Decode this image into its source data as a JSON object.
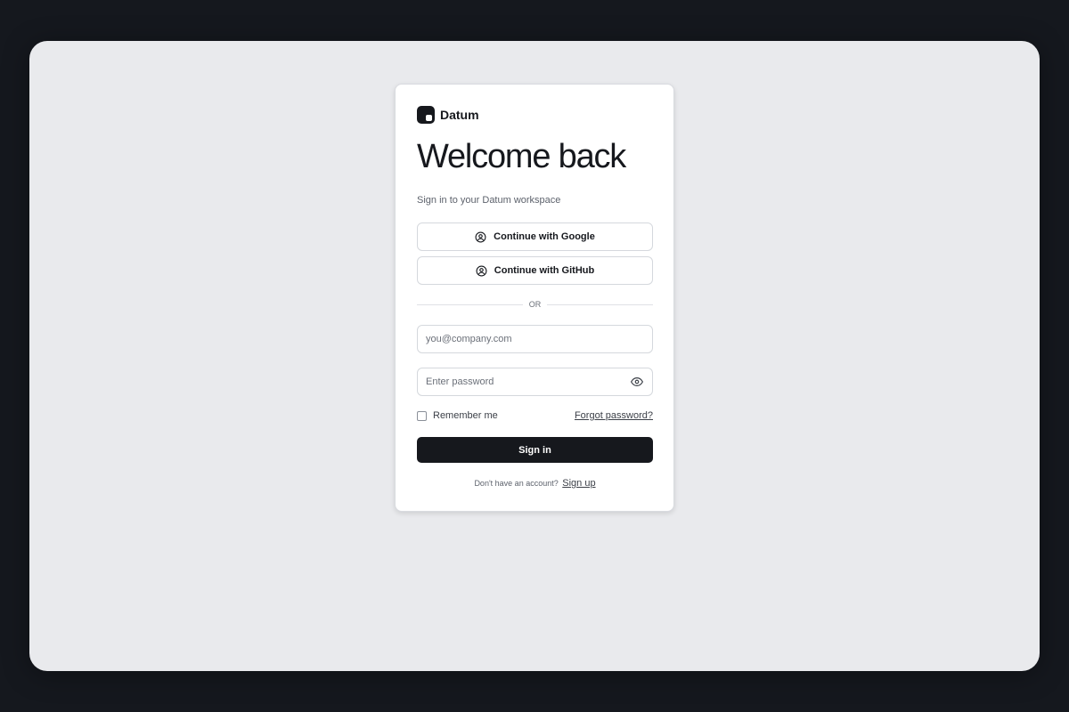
{
  "brand": {
    "name": "Datum"
  },
  "login": {
    "title": "Welcome back",
    "subtitle": "Sign in to your Datum workspace",
    "google_label": "Continue with Google",
    "github_label": "Continue with GitHub",
    "divider_text": "OR",
    "email_placeholder": "you@company.com",
    "email_value": "",
    "password_placeholder": "Enter password",
    "password_value": "",
    "remember_label": "Remember me",
    "remember_checked": false,
    "forgot_label": "Forgot password?",
    "submit_label": "Sign in",
    "footer_text": "Don't have an account?",
    "signup_label": "Sign up"
  },
  "icons": {
    "brand": "logo-icon",
    "google": "user-circle-icon",
    "github": "user-circle-icon",
    "password_toggle": "eye-icon"
  },
  "colors": {
    "backdrop": "#15181e",
    "window_bg": "#e9eaed",
    "card_bg": "#ffffff",
    "primary": "#16181d",
    "muted_text": "#5d626c",
    "border": "#d5d8dd"
  }
}
